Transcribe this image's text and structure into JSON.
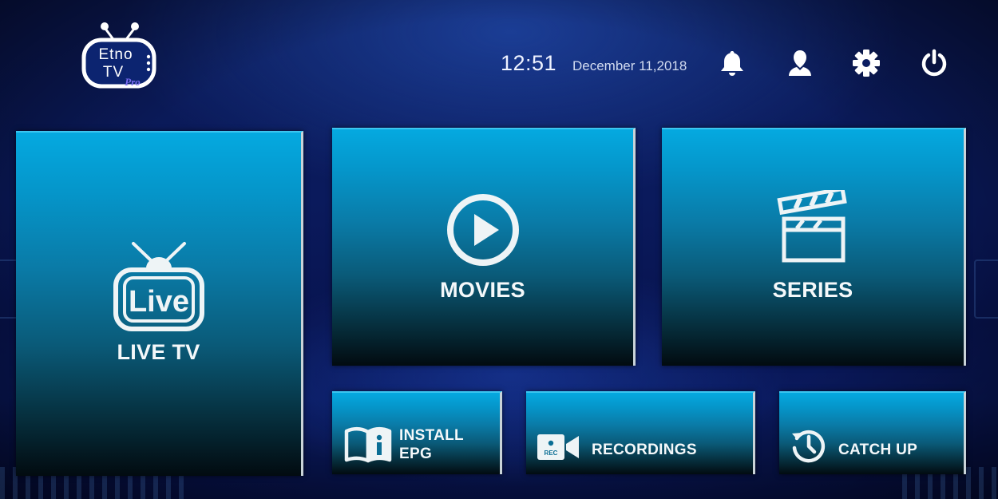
{
  "app": {
    "logo_text_line1": "Etno",
    "logo_text_line2": "TV",
    "logo_badge": "Pro"
  },
  "header": {
    "time": "12:51",
    "date": "December 11,2018",
    "icons": [
      "bell-icon",
      "user-icon",
      "gear-icon",
      "power-icon"
    ]
  },
  "tiles": {
    "live_tv": {
      "label": "LIVE TV",
      "icon": "live-tv-icon",
      "icon_text": "Live"
    },
    "movies": {
      "label": "MOVIES",
      "icon": "play-circle-icon"
    },
    "series": {
      "label": "SERIES",
      "icon": "clapperboard-icon"
    },
    "install_epg": {
      "label_line1": "INSTALL",
      "label_line2": "EPG",
      "icon": "book-info-icon"
    },
    "recordings": {
      "label": "RECORDINGS",
      "icon": "rec-camera-icon",
      "icon_text": "REC"
    },
    "catch_up": {
      "label": "CATCH UP",
      "icon": "history-clock-icon"
    }
  },
  "colors": {
    "tile_top": "#05a9e0",
    "tile_bottom": "#020b10",
    "background": "#0a1a5c",
    "text": "#ffffff"
  }
}
